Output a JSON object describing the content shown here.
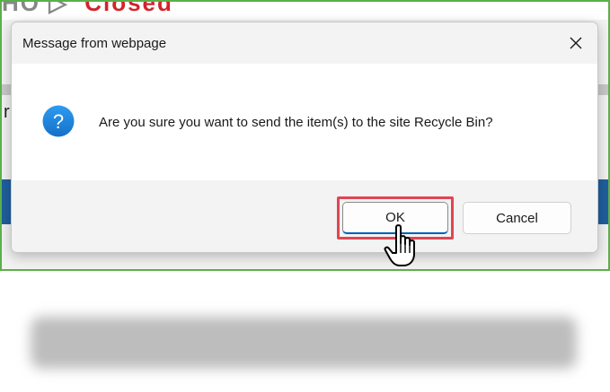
{
  "background": {
    "partial_heading": "HO",
    "partial_status": "Closed",
    "partial_letter": "r"
  },
  "dialog": {
    "title": "Message from webpage",
    "close_icon": "close-icon",
    "question_icon": "question-icon",
    "message": "Are you sure you want to send the item(s) to the site Recycle Bin?",
    "ok_label": "OK",
    "cancel_label": "Cancel"
  },
  "colors": {
    "frame_border": "#5bb04a",
    "highlight": "#e04552",
    "icon_blue": "#1e88e5",
    "status_red": "#d2232a"
  }
}
